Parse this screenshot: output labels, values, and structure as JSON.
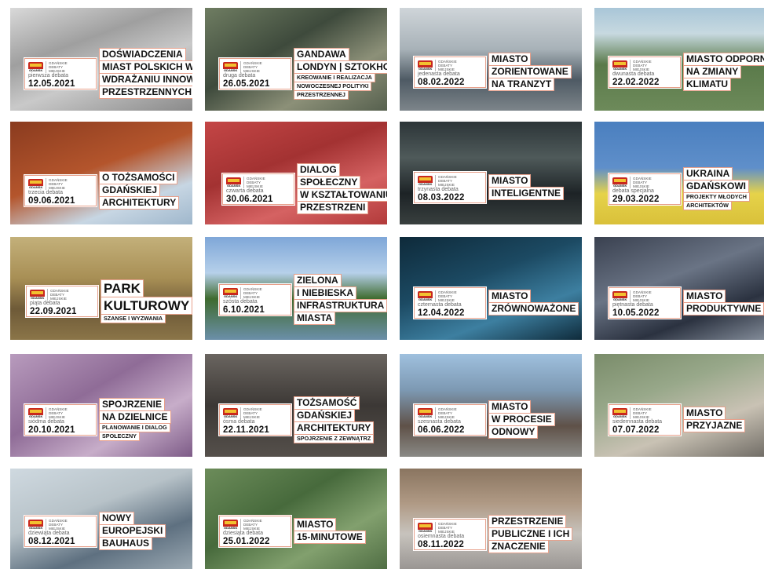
{
  "logo": {
    "crest_text": "GDAŃSK",
    "text": [
      "GDAŃSKIE",
      "DEBATY",
      "MIEJSKIE"
    ]
  },
  "tiles": [
    {
      "debate": "pierwsza debata",
      "date": "12.05.2021",
      "title": [
        "DOŚWIADCZENIA",
        "MIAST POLSKICH WE",
        "WDRAŻANIU INNOWACJI",
        "PRZESTRZENNYCH"
      ]
    },
    {
      "debate": "druga debata",
      "date": "26.05.2021",
      "title": [
        "GANDAWA",
        "LONDYN | SZTOKHOLM"
      ],
      "subtitle": [
        "KREOWANIE I REALIZACJA",
        "NOWOCZESNEJ POLITYKI",
        "PRZESTRZENNEJ"
      ]
    },
    {
      "debate": "jedenasta debata",
      "date": "08.02.2022",
      "title": [
        "MIASTO",
        "ZORIENTOWANE",
        "NA TRANZYT"
      ]
    },
    {
      "debate": "dwunasta debata",
      "date": "22.02.2022",
      "title": [
        "MIASTO ODPORNE",
        "NA ZMIANY",
        "KLIMATU"
      ]
    },
    {
      "debate": "trzecia debata",
      "date": "09.06.2021",
      "title": [
        "O TOŻSAMOŚCI",
        "GDAŃSKIEJ",
        "ARCHITEKTURY"
      ]
    },
    {
      "debate": "czwarta debata",
      "date": "30.06.2021",
      "title": [
        "DIALOG",
        "SPOŁECZNY",
        "W KSZTAŁTOWANIU",
        "PRZESTRZENI"
      ]
    },
    {
      "debate": "trzynasta debata",
      "date": "08.03.2022",
      "title": [
        "MIASTO",
        "INTELIGENTNE"
      ]
    },
    {
      "debate": "debata specjalna",
      "date": "29.03.2022",
      "title": [
        "UKRAINA",
        "GDAŃSKOWI"
      ],
      "subtitle": [
        "PROJEKTY MŁODYCH",
        "ARCHITEKTÓW"
      ]
    },
    {
      "debate": "piąta debata",
      "date": "22.09.2021",
      "title": [
        "PARK",
        "KULTUROWY"
      ],
      "subtitle": [
        "SZANSE I WYZWANIA"
      ]
    },
    {
      "debate": "szósta debata",
      "date": "6.10.2021",
      "title": [
        "ZIELONA",
        "I NIEBIESKA",
        "INFRASTRUKTURA",
        "MIASTA"
      ]
    },
    {
      "debate": "czternasta debata",
      "date": "12.04.2022",
      "title": [
        "MIASTO",
        "ZRÓWNOWAŻONE"
      ]
    },
    {
      "debate": "piętnasta debata",
      "date": "10.05.2022",
      "title": [
        "MIASTO",
        "PRODUKTYWNE"
      ]
    },
    {
      "debate": "siódma debata",
      "date": "20.10.2021",
      "title": [
        "SPOJRZENIE",
        "NA DZIELNICE"
      ],
      "subtitle": [
        "PLANOWANIE I DIALOG",
        "SPOŁECZNY"
      ]
    },
    {
      "debate": "ósma debata",
      "date": "22.11.2021",
      "title": [
        "TOŻSAMOŚĆ",
        "GDAŃSKIEJ",
        "ARCHITEKTURY"
      ],
      "subtitle": [
        "SPOJRZENIE Z ZEWNĄTRZ"
      ]
    },
    {
      "debate": "szesnasta debata",
      "date": "06.06.2022",
      "title": [
        "MIASTO",
        "W PROCESIE",
        "ODNOWY"
      ]
    },
    {
      "debate": "siedemnasta debata",
      "date": "07.07.2022",
      "title": [
        "MIASTO",
        "PRZYJAZNE"
      ]
    },
    {
      "debate": "dziewiąta debata",
      "date": "08.12.2021",
      "title": [
        "NOWY",
        "EUROPEJSKI",
        "BAUHAUS"
      ]
    },
    {
      "debate": "dziesiąta debata",
      "date": "25.01.2022",
      "title": [
        "MIASTO",
        "15-MINUTOWE"
      ]
    },
    {
      "debate": "osiemnasta debata",
      "date": "08.11.2022",
      "title": [
        "PRZESTRZENIE",
        "PUBLICZNE I ICH",
        "ZNACZENIE"
      ]
    }
  ]
}
